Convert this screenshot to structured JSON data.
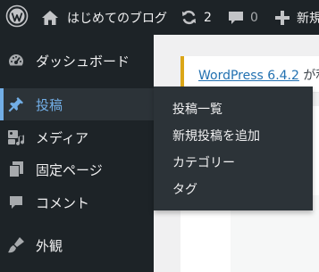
{
  "admin_bar": {
    "site_name": "はじめてのブログ",
    "updates_count": "2",
    "comments_count": "0",
    "new_label": "新規"
  },
  "admin_menu": {
    "items": [
      {
        "label": "ダッシュボード",
        "icon": "dashboard-icon"
      },
      {
        "label": "投稿",
        "icon": "pin-icon",
        "current": true
      },
      {
        "label": "メディア",
        "icon": "media-icon"
      },
      {
        "label": "固定ページ",
        "icon": "pages-icon"
      },
      {
        "label": "コメント",
        "icon": "comment-icon"
      },
      {
        "label": "外観",
        "icon": "appearance-icon"
      }
    ]
  },
  "posts_submenu": {
    "items": [
      "投稿一覧",
      "新規投稿を追加",
      "カテゴリー",
      "タグ"
    ]
  },
  "notice": {
    "link_text": "WordPress 6.4.2",
    "text": " が利"
  },
  "colors": {
    "adminbar_bg": "#1d2327",
    "menu_bg": "#1d2327",
    "submenu_bg": "#2c3338",
    "current_blue": "#72aee6",
    "notice_border": "#dba617",
    "link_blue": "#2271b1"
  }
}
